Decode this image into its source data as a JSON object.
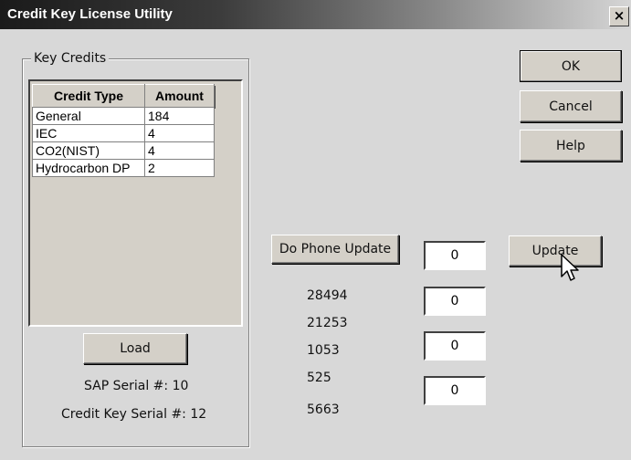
{
  "window": {
    "title": "Credit Key License Utility",
    "close_label": "×"
  },
  "buttons": {
    "ok": "OK",
    "cancel": "Cancel",
    "help": "Help",
    "do_phone_update": "Do Phone Update",
    "update": "Update",
    "load": "Load"
  },
  "key_credits": {
    "legend": "Key Credits",
    "columns": [
      "Credit Type",
      "Amount"
    ],
    "rows": [
      {
        "type": "General",
        "amount": "184"
      },
      {
        "type": "IEC",
        "amount": "4"
      },
      {
        "type": "CO2(NIST)",
        "amount": "4"
      },
      {
        "type": "Hydrocarbon DP",
        "amount": "2"
      }
    ],
    "sap_serial": "SAP Serial #: 10",
    "credit_key_serial": "Credit Key Serial #: 12"
  },
  "phone_codes": [
    "28494",
    "21253",
    "1053",
    "525",
    "5663"
  ],
  "input_fields": [
    "0",
    "0",
    "0",
    "0"
  ]
}
